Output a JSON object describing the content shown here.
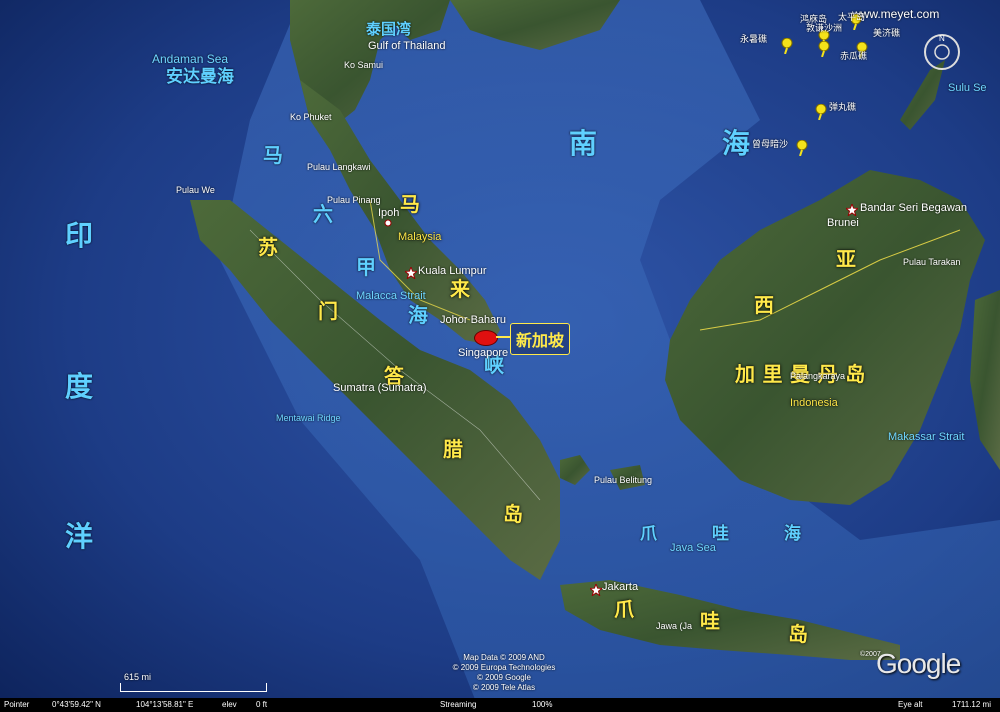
{
  "watermark": "www.meyet.com",
  "seas_cn": {
    "gulf_thailand_cn": "泰国湾",
    "andaman_cn": "安达曼海",
    "indian_ocean": [
      "印",
      "度",
      "洋"
    ],
    "south_china_sea": [
      "南",
      "海"
    ],
    "malacca": [
      "马",
      "六",
      "甲",
      "海",
      "峡"
    ],
    "java_sea": [
      "爪",
      "哇",
      "海"
    ]
  },
  "seas_en": {
    "gulf_thailand": "Gulf of Thailand",
    "andaman": "Andaman Sea",
    "sulu": "Sulu Se",
    "malacca": "Malacca Strait",
    "java_sea": "Java Sea",
    "makassar": "Makassar Strait",
    "mentawai": "Mentawai Ridge"
  },
  "islands_cn": {
    "sumatra": [
      "苏",
      "门",
      "答",
      "腊",
      "岛"
    ],
    "malay": [
      "马",
      "来"
    ],
    "borneo": "加 里 曼 丹 岛",
    "borneo_top": [
      "亚",
      "西"
    ],
    "java": [
      "爪",
      "哇",
      "岛"
    ]
  },
  "islands_en": {
    "sumatra": "Sumatra (Sumatra)",
    "java": "Jawa (Ja",
    "pulau_we": "Pulau We",
    "pulau_belitung": "Pulau Belitung",
    "pulau_penang": "Pulau Pinang",
    "pulau_langkawi": "Pulau Langkawi",
    "ko_phuket": "Ko Phuket",
    "ko_samui": "Ko Samui"
  },
  "places": {
    "malaysia": "Malaysia",
    "indonesia": "Indonesia",
    "brunei": "Brunei",
    "ipoh": "Ipoh",
    "kuala_lumpur": "Kuala Lumpur",
    "johor": "Johor Baharu",
    "singapore": "Singapore",
    "singapore_cn": "新加坡",
    "jakarta": "Jakarta",
    "bandar": "Bandar Seri Begawan",
    "palangkaraya": "Palangkaraya",
    "pulau_tarakan": "Pulau Tarakan"
  },
  "spratly_pins": {
    "p1": "鸿庥岛",
    "p2": "敦谦沙洲",
    "p3": "永暑礁",
    "p4": "太平岛",
    "p5": "美济礁",
    "p6": "赤瓜礁",
    "p7": "弹丸礁",
    "p8": "曾母暗沙"
  },
  "pin_color": "#f4e21a",
  "sea_color": "#1b3f8f",
  "land_color": "#3d5a2e",
  "attribution": {
    "line1": "Map Data © 2009 AND",
    "line2": "© 2009 Europa Technologies",
    "line3": "© 2009 Google",
    "line4": "© 2009 Tele Atlas"
  },
  "google_logo": "Google",
  "copyright_small": "©2007",
  "scale": "615 mi",
  "status": {
    "pointer_label": "Pointer",
    "lat": "0°43'59.42\" N",
    "lon": "104°13'58.81\" E",
    "elev_label": "elev",
    "elev": "0 ft",
    "streaming_label": "Streaming",
    "streaming_value": "100%",
    "eye_label": "Eye alt",
    "eye_value": "1711.12 mi"
  }
}
